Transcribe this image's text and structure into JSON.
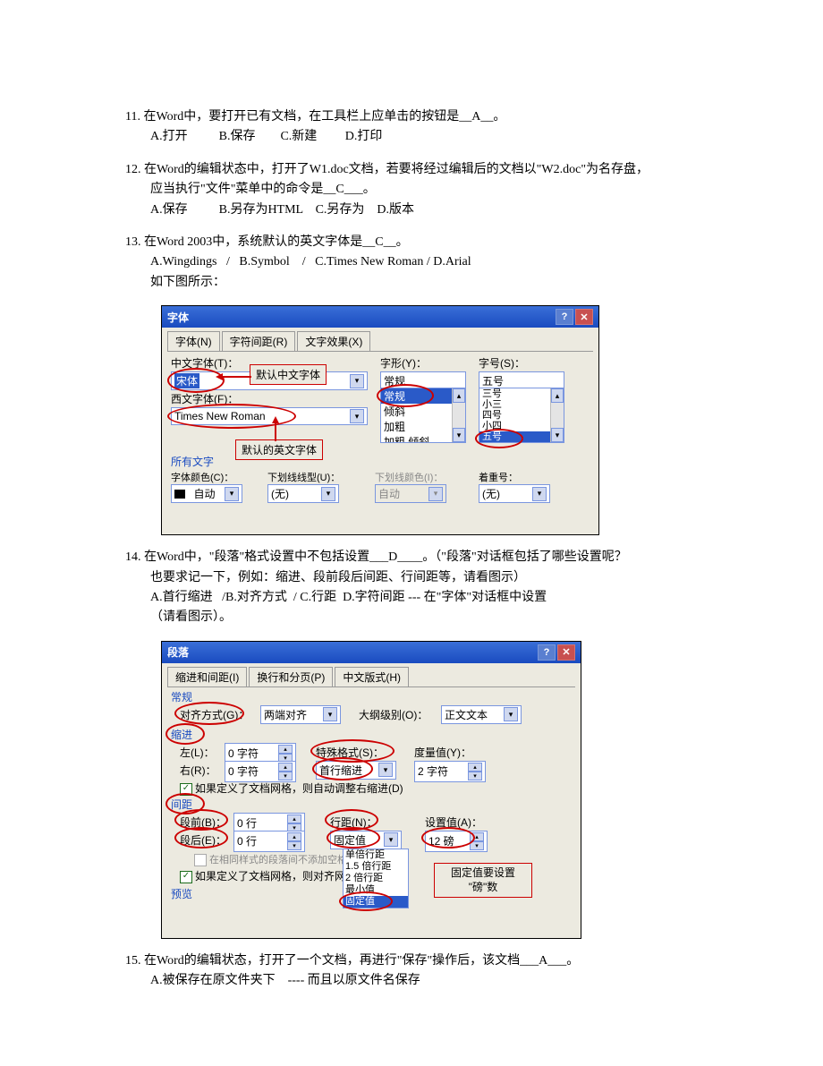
{
  "q11": {
    "num": "11.",
    "text": "在Word中，要打开已有文档，在工具栏上应单击的按钮是__A__。",
    "opts": "A.打开          B.保存        C.新建         D.打印"
  },
  "q12": {
    "num": "12.",
    "line1": "在Word的编辑状态中，打开了W1.doc文档，若要将经过编辑后的文档以\"W2.doc\"为名存盘，",
    "line2": "应当执行\"文件\"菜单中的命令是__C___。",
    "opts": "A.保存          B.另存为HTML    C.另存为    D.版本"
  },
  "q13": {
    "num": "13.",
    "line1": "在Word 2003中，系统默认的英文字体是__C__。",
    "opts": "A.Wingdings   /   B.Symbol    /   C.Times New Roman / D.Arial",
    "note": "如下图所示："
  },
  "fontDlg": {
    "title": "字体",
    "tabs": [
      "字体(N)",
      "字符间距(R)",
      "文字效果(X)"
    ],
    "cnFontLabel": "中文字体(T)：",
    "cnFontValue": "宋体",
    "enFontLabel": "西文字体(F)：",
    "enFontValue": "Times New Roman",
    "styleLabel": "字形(Y)：",
    "styleValue": "常规",
    "styleList": [
      "常规",
      "倾斜",
      "加粗",
      "加粗 倾斜"
    ],
    "sizeLabel": "字号(S)：",
    "sizeValue": "五号",
    "sizeList": [
      "三号",
      "小三",
      "四号",
      "小四",
      "五号"
    ],
    "allText": "所有文字",
    "colorLabel": "字体颜色(C)：",
    "colorValue": "自动",
    "uStyleLabel": "下划线线型(U)：",
    "uStyleValue": "(无)",
    "uColorLabel": "下划线颜色(I)：",
    "uColorValue": "自动",
    "emphLabel": "着重号：",
    "emphValue": "(无)",
    "callout1": "默认中文字体",
    "callout2": "默认的英文字体"
  },
  "q14": {
    "num": "14.",
    "line1": "在Word中，\"段落\"格式设置中不包括设置___D____。（\"段落\"对话框包括了哪些设置呢？",
    "line2": "也要求记一下，例如：缩进、段前段后间距、行间距等，请看图示）",
    "opts": "A.首行缩进   /B.对齐方式  / C.行距  D.字符间距 --- 在\"字体\"对话框中设置",
    "note": "（请看图示）。"
  },
  "paraDlg": {
    "title": "段落",
    "tabs": [
      "缩进和间距(I)",
      "换行和分页(P)",
      "中文版式(H)"
    ],
    "secGeneral": "常规",
    "alignLabel": "对齐方式(G)：",
    "alignValue": "两端对齐",
    "outlineLabel": "大纲级别(O)：",
    "outlineValue": "正文文本",
    "secIndent": "缩进",
    "leftLabel": "左(L)：",
    "leftValue": "0 字符",
    "rightLabel": "右(R)：",
    "rightValue": "0 字符",
    "specialLabel": "特殊格式(S)：",
    "specialValue": "首行缩进",
    "measureLabel": "度量值(Y)：",
    "measureValue": "2 字符",
    "chk1": "如果定义了文档网格，则自动调整右缩进(D)",
    "secSpacing": "间距",
    "beforeLabel": "段前(B)：",
    "beforeValue": "0 行",
    "afterLabel": "段后(E)：",
    "afterValue": "0 行",
    "lineLabel": "行距(N)：",
    "lineValue": "固定值",
    "setLabel": "设置值(A)：",
    "setValue": "12 磅",
    "grayNote": "在相同样式的段落间不添加空格",
    "chk2": "如果定义了文档网格，则对齐网",
    "dropdown": [
      "单倍行距",
      "1.5 倍行距",
      "2 倍行距",
      "最小值",
      "固定值"
    ],
    "preview": "预览",
    "callout1": "固定值要设置",
    "callout2": "\"磅\"数"
  },
  "q15": {
    "num": "15.",
    "text": "在Word的编辑状态，打开了一个文档，再进行\"保存\"操作后，该文档___A___。",
    "optA": "A.被保存在原文件夹下    ---- 而且以原文件名保存"
  }
}
